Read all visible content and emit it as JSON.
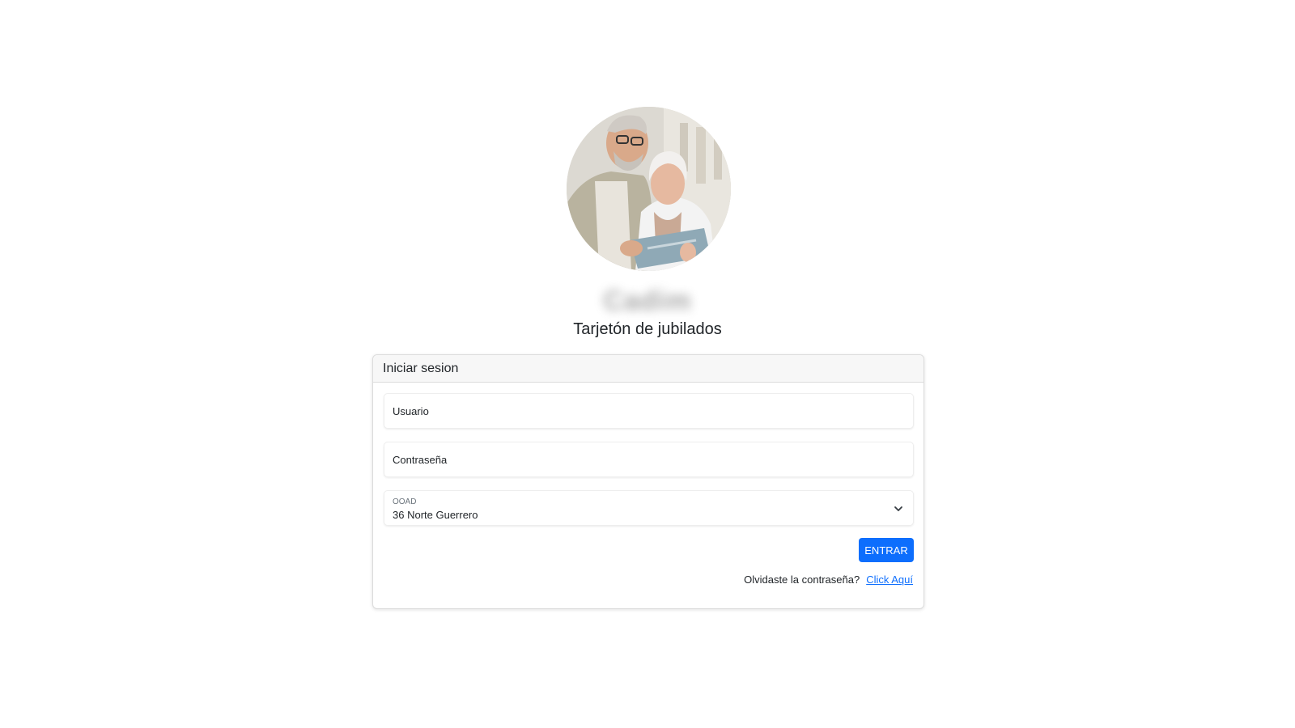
{
  "header": {
    "brand_name": "Cadim",
    "subtitle": "Tarjetón de jubilados"
  },
  "login_card": {
    "title": "Iniciar sesion",
    "username": {
      "placeholder": "Usuario",
      "value": ""
    },
    "password": {
      "placeholder": "Contraseña",
      "value": ""
    },
    "ooad_select": {
      "label": "OOAD",
      "selected": "36 Norte Guerrero"
    },
    "submit_label": "ENTRAR",
    "forgot_text": "Olvidaste la contraseña?",
    "forgot_link": "Click Aquí"
  },
  "colors": {
    "primary": "#0d6efd",
    "card_header_bg": "#f7f7f7",
    "border": "#dcdcdc"
  },
  "icons": {
    "select_arrow": "chevron-down-icon"
  }
}
